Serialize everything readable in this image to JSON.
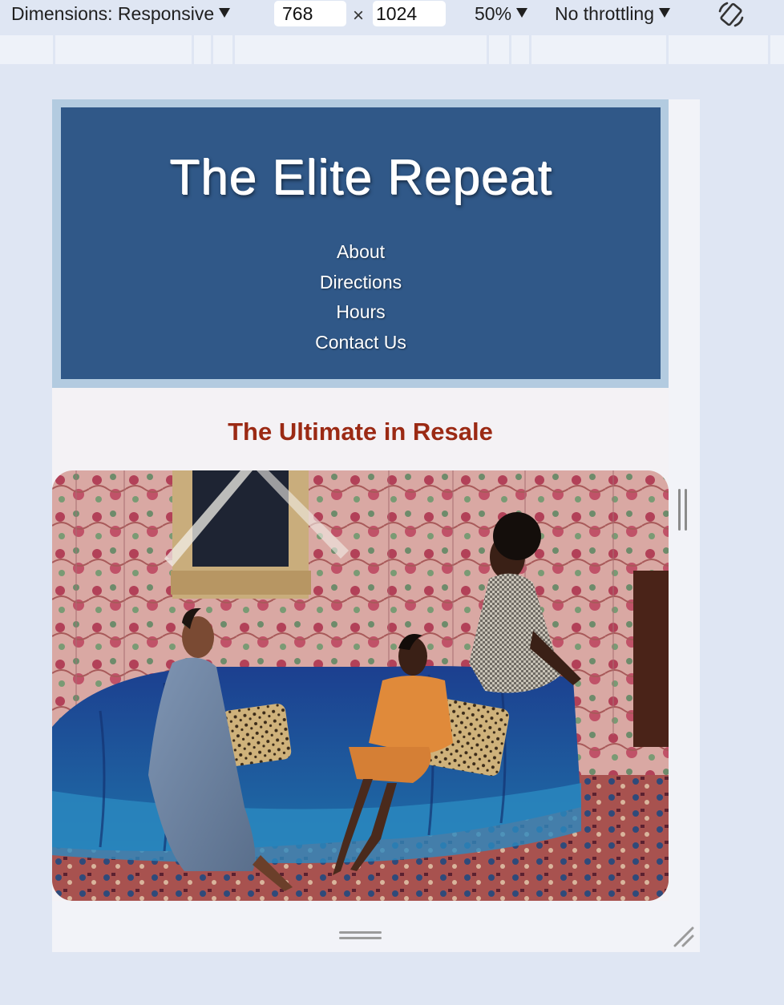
{
  "devtools": {
    "dimensions_label": "Dimensions: Responsive",
    "width_value": "768",
    "times_sign": "×",
    "height_value": "1024",
    "zoom": "50%",
    "throttling": "No throttling",
    "rotate_icon": "rotate-device-icon"
  },
  "site": {
    "title": "The Elite Repeat",
    "nav": [
      "About",
      "Directions",
      "Hours",
      "Contact Us"
    ],
    "tagline": "The Ultimate in Resale",
    "colors": {
      "header_bg": "#305888",
      "header_border": "#b3cbe0",
      "tagline": "#9b2a14"
    }
  }
}
